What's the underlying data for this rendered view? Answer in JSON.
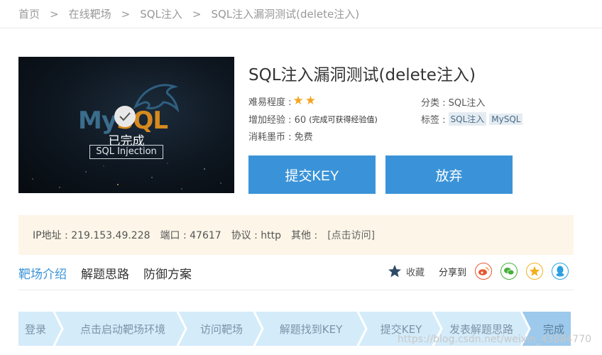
{
  "breadcrumb": [
    "首页",
    "在线靶场",
    "SQL注入",
    "SQL注入漏洞测试(delete注入)"
  ],
  "breadcrumb_sep": ">",
  "hero": {
    "logo_my": "My",
    "logo_sql": "SQL",
    "status": "已完成",
    "tag": "SQL Injection"
  },
  "title": "SQL注入漏洞测试(delete注入)",
  "info": {
    "difficulty_label": "难易程度 :",
    "difficulty_stars": 2,
    "exp_label": "增加经验 : 60",
    "exp_note": "(完成可获得经验值)",
    "cost_label": "消耗墨币 : 免费",
    "category_label": "分类 : SQL注入",
    "tags_label": "标签 :",
    "tags": [
      "SQL注入",
      "MySQL"
    ]
  },
  "buttons": {
    "submit": "提交KEY",
    "abandon": "放弃"
  },
  "ipbar": {
    "ip": "IP地址 : 219.153.49.228",
    "port": "端口 : 47617",
    "protocol": "协议 : http",
    "other": "其他 :",
    "link": "[点击访问]"
  },
  "tabs": [
    "靶场介绍",
    "解题思路",
    "防御方案"
  ],
  "fav_label": "收藏",
  "share_label": "分享到",
  "steps": [
    "登录",
    "点击启动靶场环境",
    "访问靶场",
    "解题找到KEY",
    "提交KEY",
    "发表解题思路",
    "完成"
  ],
  "watermark": "https://blog.csdn.net/weixin_43884770",
  "colors": {
    "accent": "#3a93d8",
    "star": "#f4a522",
    "step_bg": "#d4ebfa",
    "step_last": "#9cc9ec",
    "ipbar_bg": "#fdf6e8"
  }
}
